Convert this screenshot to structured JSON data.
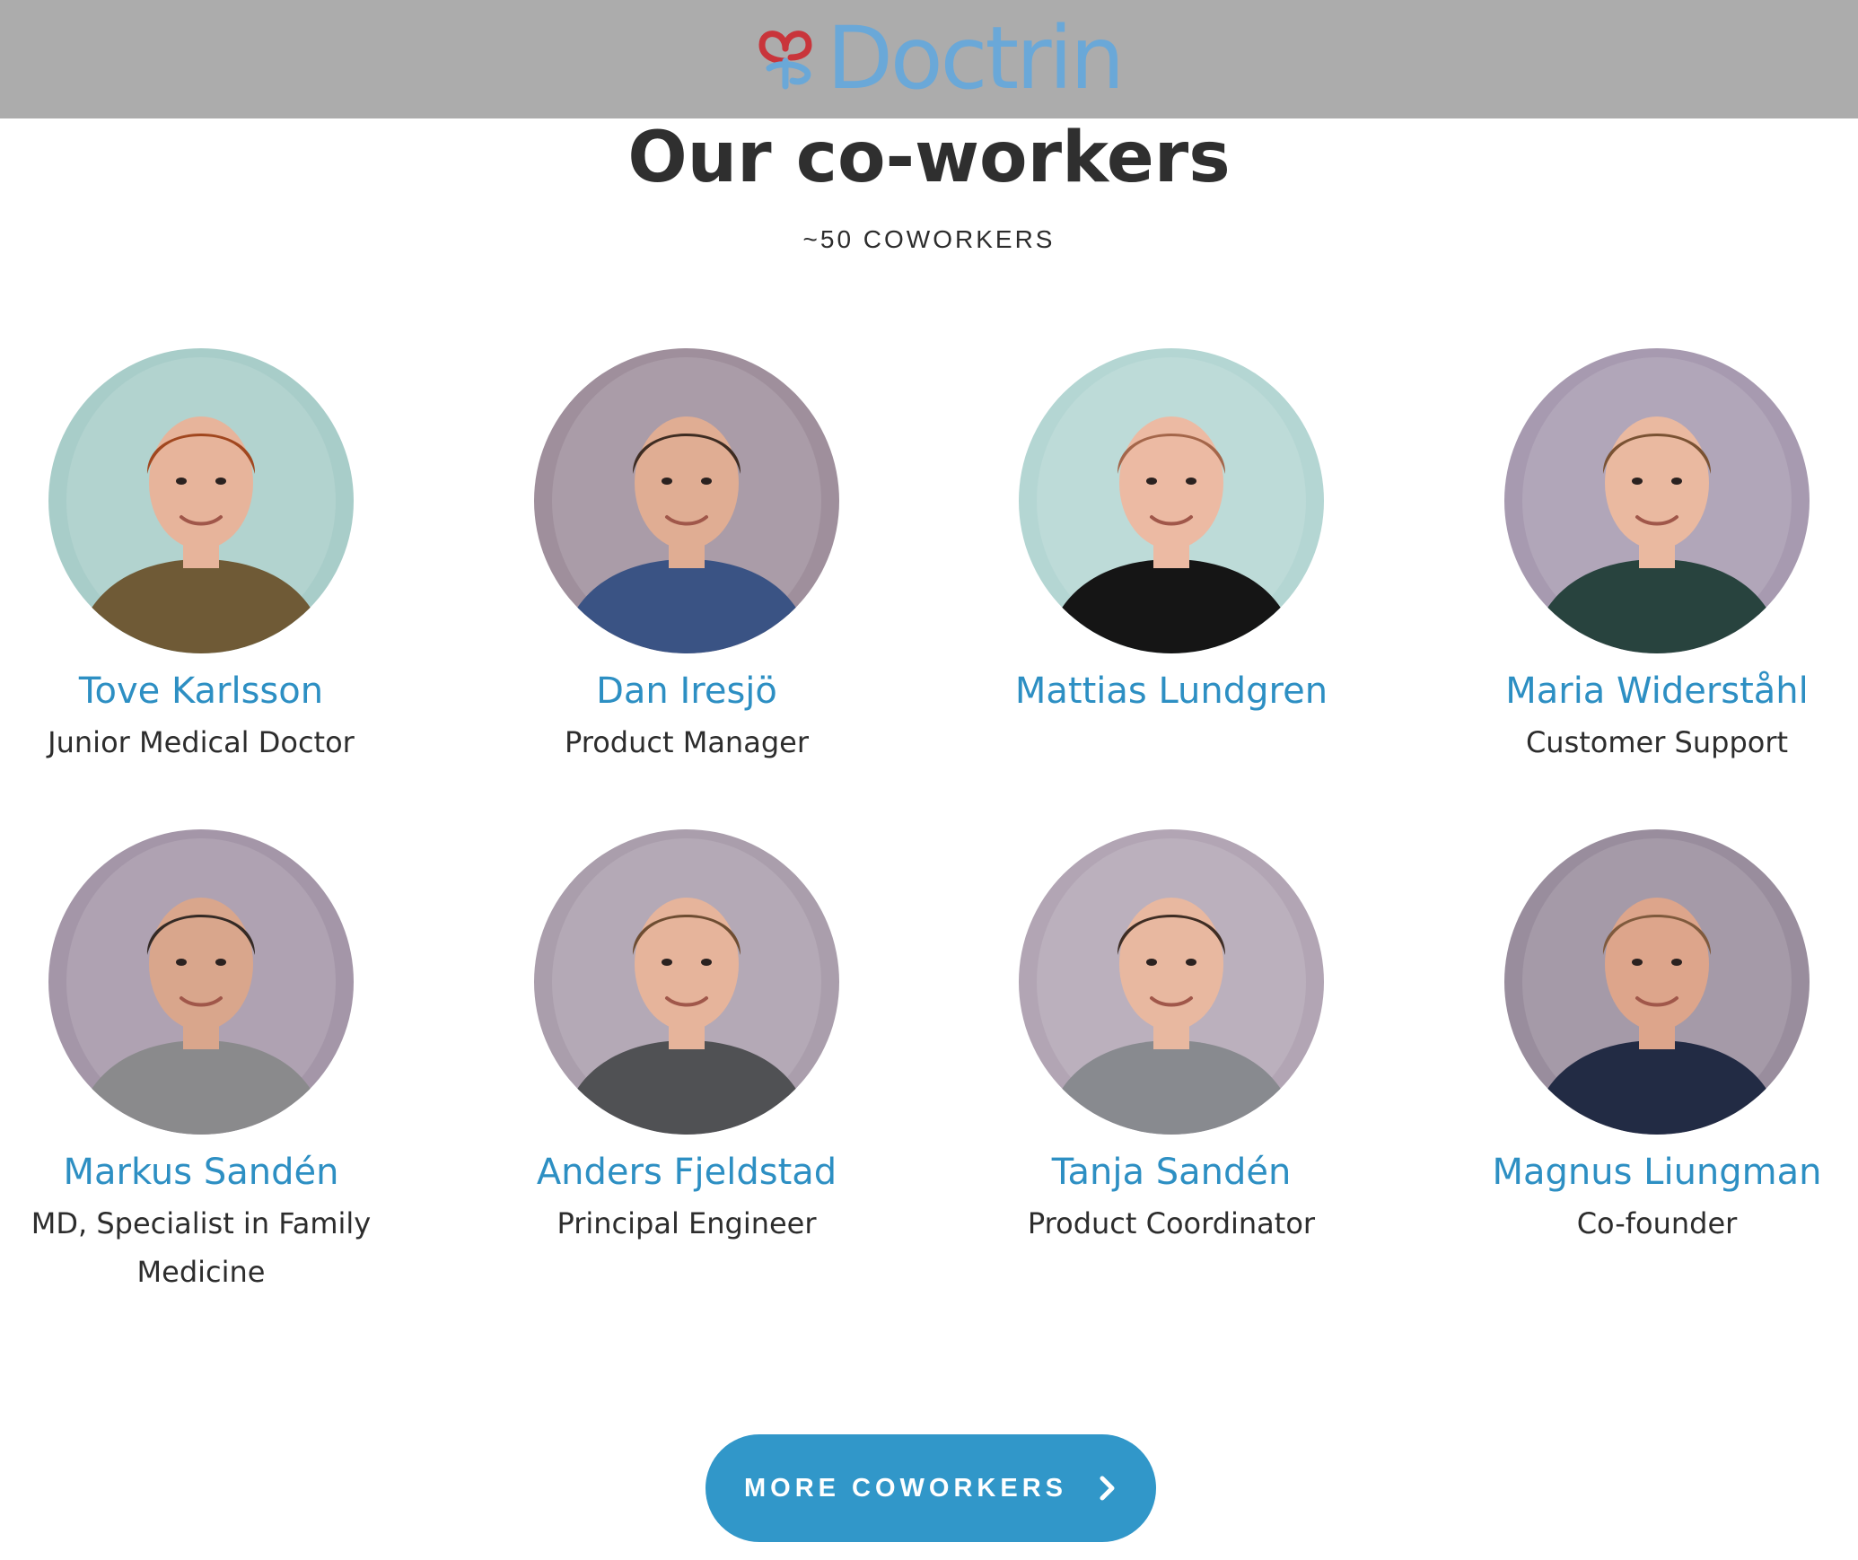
{
  "brand": {
    "name": "Doctrin",
    "color": "#6aa8d8",
    "mark_color_red": "#c9353b",
    "mark_color_blue": "#6aa8d8"
  },
  "section": {
    "title": "Our co-workers",
    "subtitle": "~50 COWORKERS"
  },
  "coworkers": [
    {
      "name": "Tove Karlsson",
      "role": "Junior Medical Doctor",
      "bg": "#a8cdc9",
      "shirt": "#6f5a36",
      "hair": "#a1471f",
      "skin": "#e7b49b"
    },
    {
      "name": "Dan Iresjö",
      "role": "Product Manager",
      "bg": "#9f8f9c",
      "shirt": "#3a5384",
      "hair": "#3e2c22",
      "skin": "#e0ad93"
    },
    {
      "name": "Mattias Lundgren",
      "role": "",
      "bg": "#b4d6d3",
      "shirt": "#151515",
      "hair": "#a4664a",
      "skin": "#ecbaa3"
    },
    {
      "name": "Maria Widerståhl",
      "role": "Customer Support",
      "bg": "#a79ab0",
      "shirt": "#28433e",
      "hair": "#7a5233",
      "skin": "#eab9a0"
    },
    {
      "name": "Markus Sandén",
      "role": "MD, Specialist in Family",
      "role2": "Medicine",
      "bg": "#a496a8",
      "shirt": "#8a8a8c",
      "hair": "#342a25",
      "skin": "#d9a68c"
    },
    {
      "name": "Anders Fjeldstad",
      "role": "Principal Engineer",
      "bg": "#aa9eac",
      "shirt": "#505154",
      "hair": "#6e4d32",
      "skin": "#e6b49b"
    },
    {
      "name": "Tanja Sandén",
      "role": "Product Coordinator",
      "bg": "#b2a5b4",
      "shirt": "#888a8f",
      "hair": "#3e2d24",
      "skin": "#e8b8a0"
    },
    {
      "name": "Magnus Liungman",
      "role": "Co-founder",
      "bg": "#998d9d",
      "shirt": "#222b44",
      "hair": "#7f5a3d",
      "skin": "#dda58b"
    }
  ],
  "more_button": {
    "label": "MORE COWORKERS",
    "icon": "chevron-right-icon",
    "color": "#3197c9"
  }
}
